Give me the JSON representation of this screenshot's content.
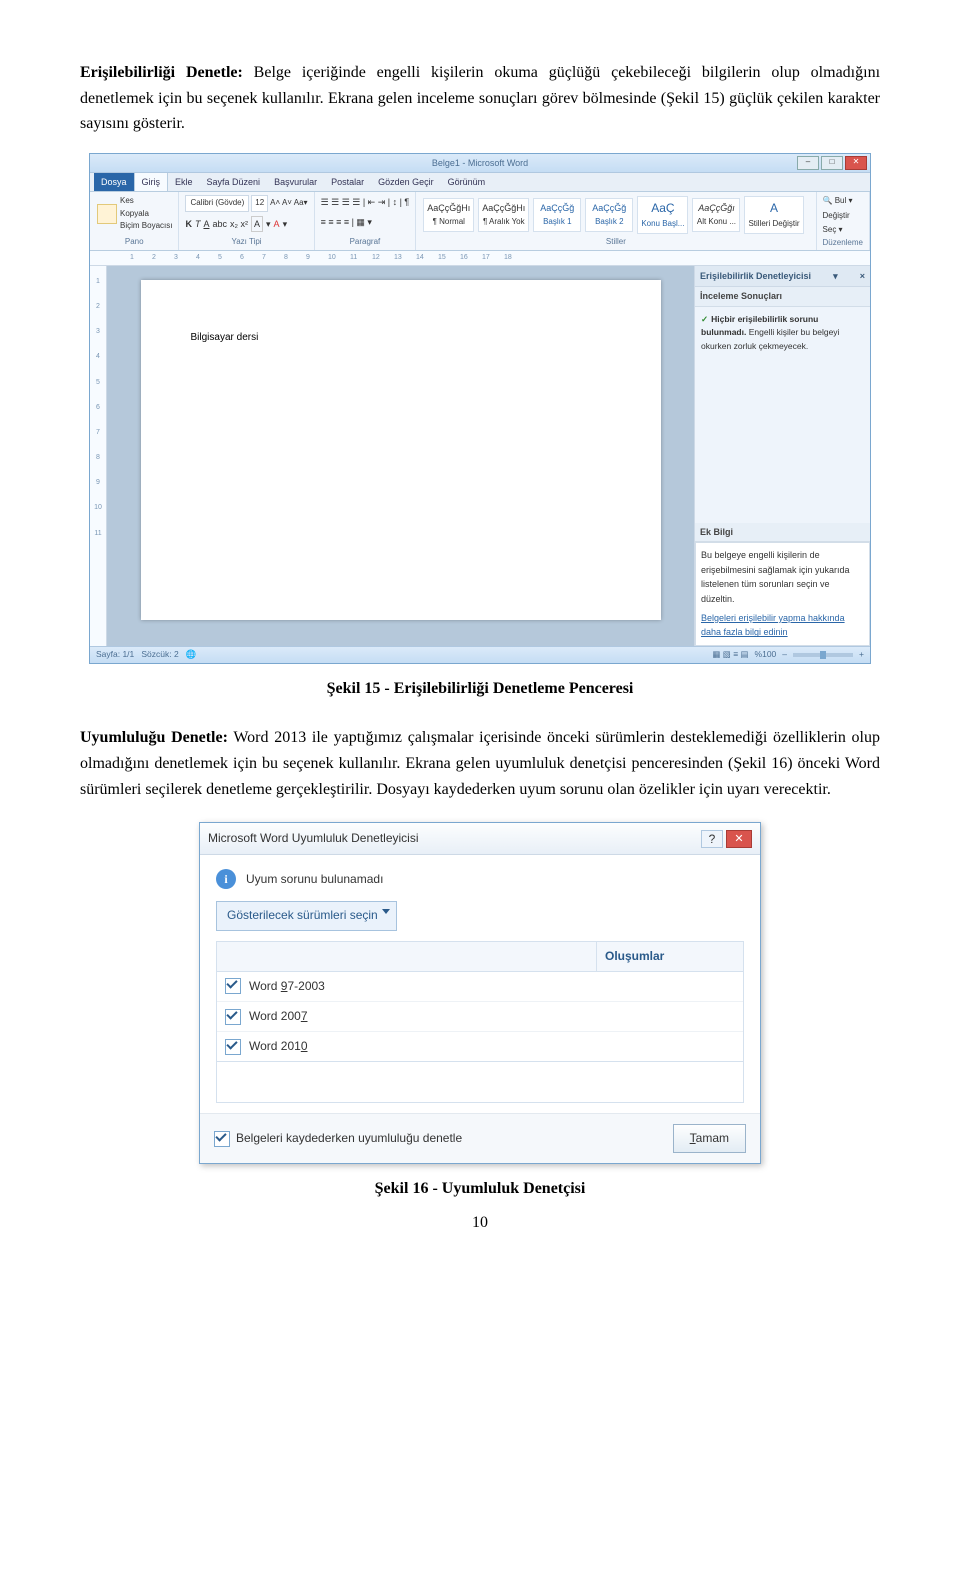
{
  "para1": {
    "lead": "Erişilebilirliği Denetle:",
    "text": " Belge içeriğinde engelli kişilerin okuma güçlüğü çekebileceği bilgilerin olup olmadığını denetlemek için bu seçenek kullanılır. Ekrana gelen inceleme sonuçları görev bölmesinde (Şekil 15) güçlük çekilen karakter sayısını gösterir."
  },
  "word": {
    "title": "Belge1 - Microsoft Word",
    "tabs": {
      "file": "Dosya",
      "home": "Giriş",
      "insert": "Ekle",
      "layout": "Sayfa Düzeni",
      "ref": "Başvurular",
      "mail": "Postalar",
      "review": "Gözden Geçir",
      "view": "Görünüm"
    },
    "clipboard": {
      "cut": "Kes",
      "copy": "Kopyala",
      "paste": "Yapıştır",
      "painter": "Biçim Boyacısı",
      "label": "Pano"
    },
    "font": {
      "name": "Calibri (Gövde)",
      "size": "12",
      "label": "Yazı Tipi"
    },
    "para_label": "Paragraf",
    "styles": {
      "sample": "AaÇçĞğHı",
      "s1": "¶ Normal",
      "s2": "¶ Aralık Yok",
      "s3": "Başlık 1",
      "s4": "Başlık 2",
      "s5": "Konu Başl...",
      "s6": "Alt Konu ...",
      "change": "Stilleri Değiştir",
      "label": "Stiller"
    },
    "editing": {
      "find": "Bul",
      "replace": "Değiştir",
      "select": "Seç",
      "label": "Düzenleme"
    },
    "doc_text": "Bilgisayar dersi",
    "ruler_h": [
      "1",
      "2",
      "3",
      "4",
      "5",
      "6",
      "7",
      "8",
      "9",
      "10",
      "11",
      "12",
      "13",
      "14",
      "15",
      "16",
      "17",
      "18"
    ],
    "ruler_v": [
      "1",
      "2",
      "3",
      "4",
      "5",
      "6",
      "7",
      "8",
      "9",
      "10",
      "11"
    ],
    "panel": {
      "title": "Erişilebilirlik Denetleyicisi",
      "close": "×",
      "sub": "İnceleme Sonuçları",
      "ok1": "Hiçbir erişilebilirlik sorunu bulunmadı.",
      "ok2": "Engelli kişiler bu belgeyi okurken zorluk çekmeyecek.",
      "ek_title": "Ek Bilgi",
      "ek1": "Bu belgeye engelli kişilerin de erişebilmesini sağlamak için yukarıda listelenen tüm sorunları seçin ve düzeltin.",
      "link": "Belgeleri erişilebilir yapma hakkında daha fazla bilgi edinin"
    },
    "status": {
      "page": "Sayfa: 1/1",
      "words": "Sözcük: 2",
      "zoom": "%100"
    }
  },
  "caption1": "Şekil 15 - Erişilebilirliği Denetleme Penceresi",
  "para2": {
    "lead": "Uyumluluğu Denetle:",
    "text": " Word 2013 ile yaptığımız çalışmalar içerisinde önceki sürümlerin desteklemediği özelliklerin olup olmadığını denetlemek için bu seçenek kullanılır. Ekrana gelen uyumluluk denetçisi penceresinden (Şekil 16) önceki Word sürümleri seçilerek denetleme gerçekleştirilir. Dosyayı kaydederken uyum sorunu olan özelikler için uyarı verecektir."
  },
  "dialog": {
    "title": "Microsoft Word Uyumluluk Denetleyicisi",
    "info": "Uyum sorunu bulunamadı",
    "select_label": "Gösterilecek sürümleri seçin",
    "col_occ": "Oluşumlar",
    "opts": [
      "Word 97-2003",
      "Word 2007",
      "Word 2010"
    ],
    "keys": [
      "9",
      "7",
      "0"
    ],
    "autocheck": "Belgeleri kaydederken uyumluluğu denetle",
    "ok": "Tamam"
  },
  "caption2": "Şekil 16 - Uyumluluk Denetçisi",
  "page_no": "10"
}
